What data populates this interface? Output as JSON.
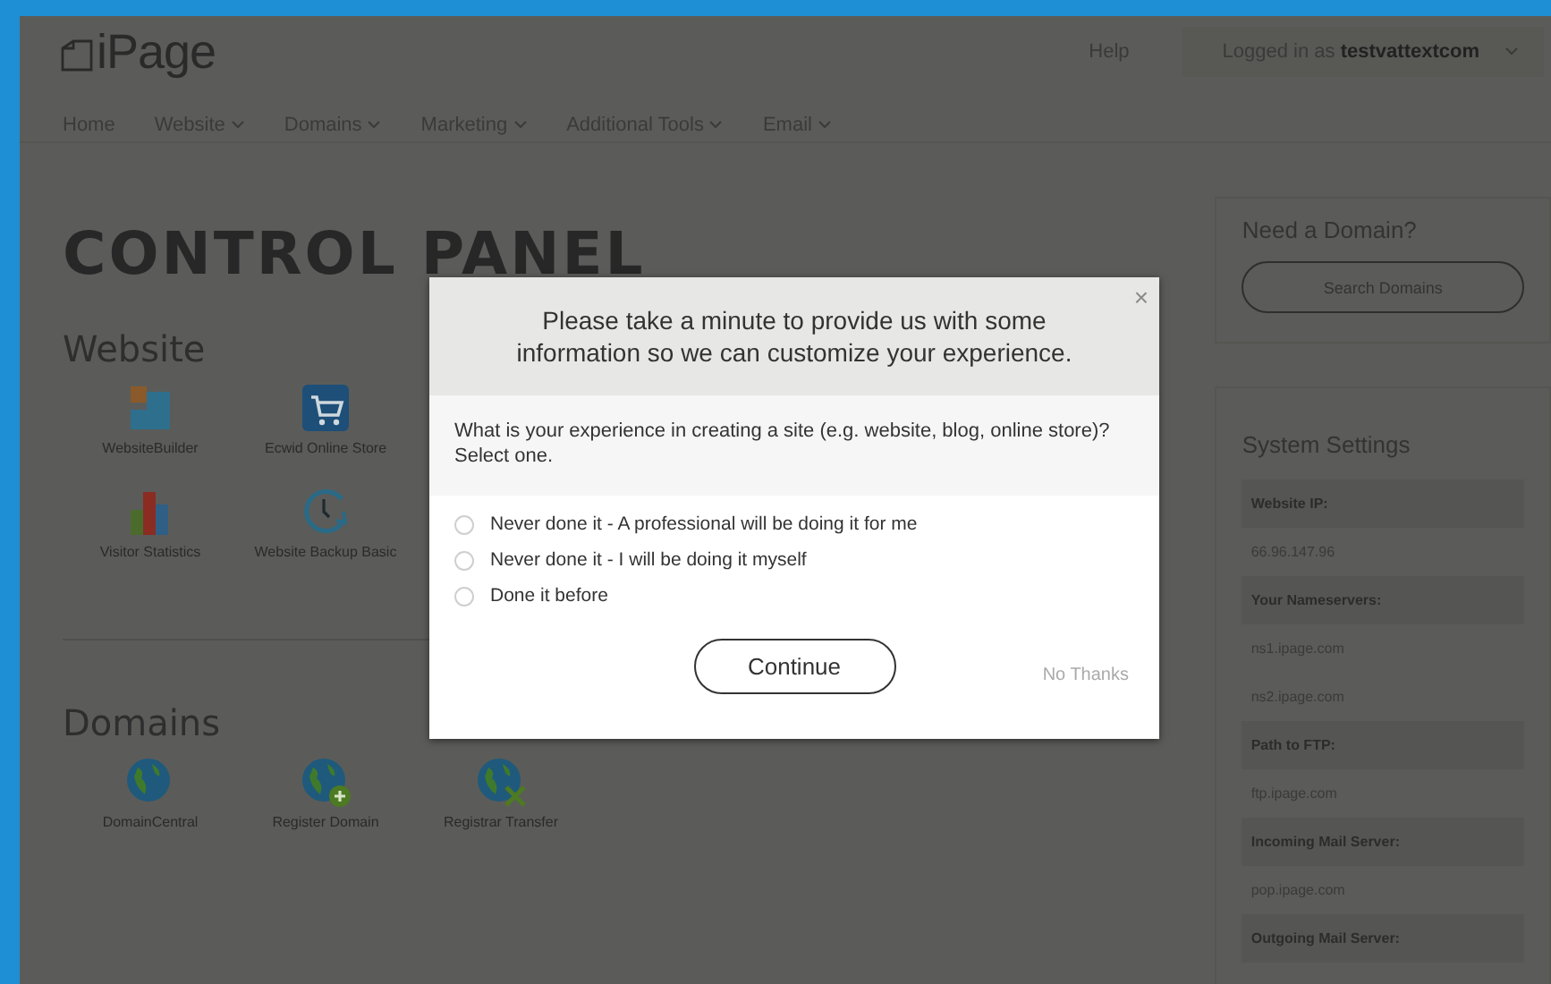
{
  "header": {
    "logo": "iPage",
    "help": "Help",
    "account": {
      "prefix": "Logged in as ",
      "user": "testvattextcom"
    }
  },
  "nav": [
    {
      "label": "Home",
      "dropdown": false
    },
    {
      "label": "Website",
      "dropdown": true
    },
    {
      "label": "Domains",
      "dropdown": true
    },
    {
      "label": "Marketing",
      "dropdown": true
    },
    {
      "label": "Additional Tools",
      "dropdown": true
    },
    {
      "label": "Email",
      "dropdown": true
    }
  ],
  "title": "CONTROL PANEL",
  "sections": [
    {
      "heading": "Website",
      "items": [
        {
          "label": "WebsiteBuilder",
          "kind": "builder"
        },
        {
          "label": "Ecwid Online Store",
          "kind": "cart"
        },
        {
          "label": "Visitor Statistics",
          "kind": "bars"
        },
        {
          "label": "Website Backup Basic",
          "kind": "clock"
        }
      ]
    },
    {
      "heading": "Domains",
      "items": [
        {
          "label": "DomainCentral",
          "kind": "globe"
        },
        {
          "label": "Register Domain",
          "kind": "globe-plus"
        },
        {
          "label": "Registrar Transfer",
          "kind": "globe-transfer"
        }
      ]
    }
  ],
  "sidebar": {
    "domain_card": {
      "title": "Need a Domain?",
      "button": "Search Domains"
    },
    "settings": {
      "title": "System Settings",
      "rows": [
        {
          "kind": "label",
          "text": "Website IP:"
        },
        {
          "kind": "value",
          "text": "66.96.147.96"
        },
        {
          "kind": "label",
          "text": "Your Nameservers:"
        },
        {
          "kind": "value",
          "text": "ns1.ipage.com"
        },
        {
          "kind": "value",
          "text": "ns2.ipage.com"
        },
        {
          "kind": "label",
          "text": "Path to FTP:"
        },
        {
          "kind": "value",
          "text": "ftp.ipage.com"
        },
        {
          "kind": "label",
          "text": "Incoming Mail Server:"
        },
        {
          "kind": "value",
          "text": "pop.ipage.com"
        },
        {
          "kind": "label",
          "text": "Outgoing Mail Server:"
        }
      ]
    }
  },
  "modal": {
    "close": "×",
    "heading": "Please take a minute to provide us with some information so we can customize your experience.",
    "question": "What is your experience in creating a site (e.g. website, blog, online store)? Select one.",
    "options": [
      {
        "label": "Never done it - A professional will be doing it for me",
        "selected": false
      },
      {
        "label": "Never done it - I will be doing it myself",
        "selected": false
      },
      {
        "label": "Done it before",
        "selected": false
      }
    ],
    "continue": "Continue",
    "dismiss": "No Thanks"
  }
}
